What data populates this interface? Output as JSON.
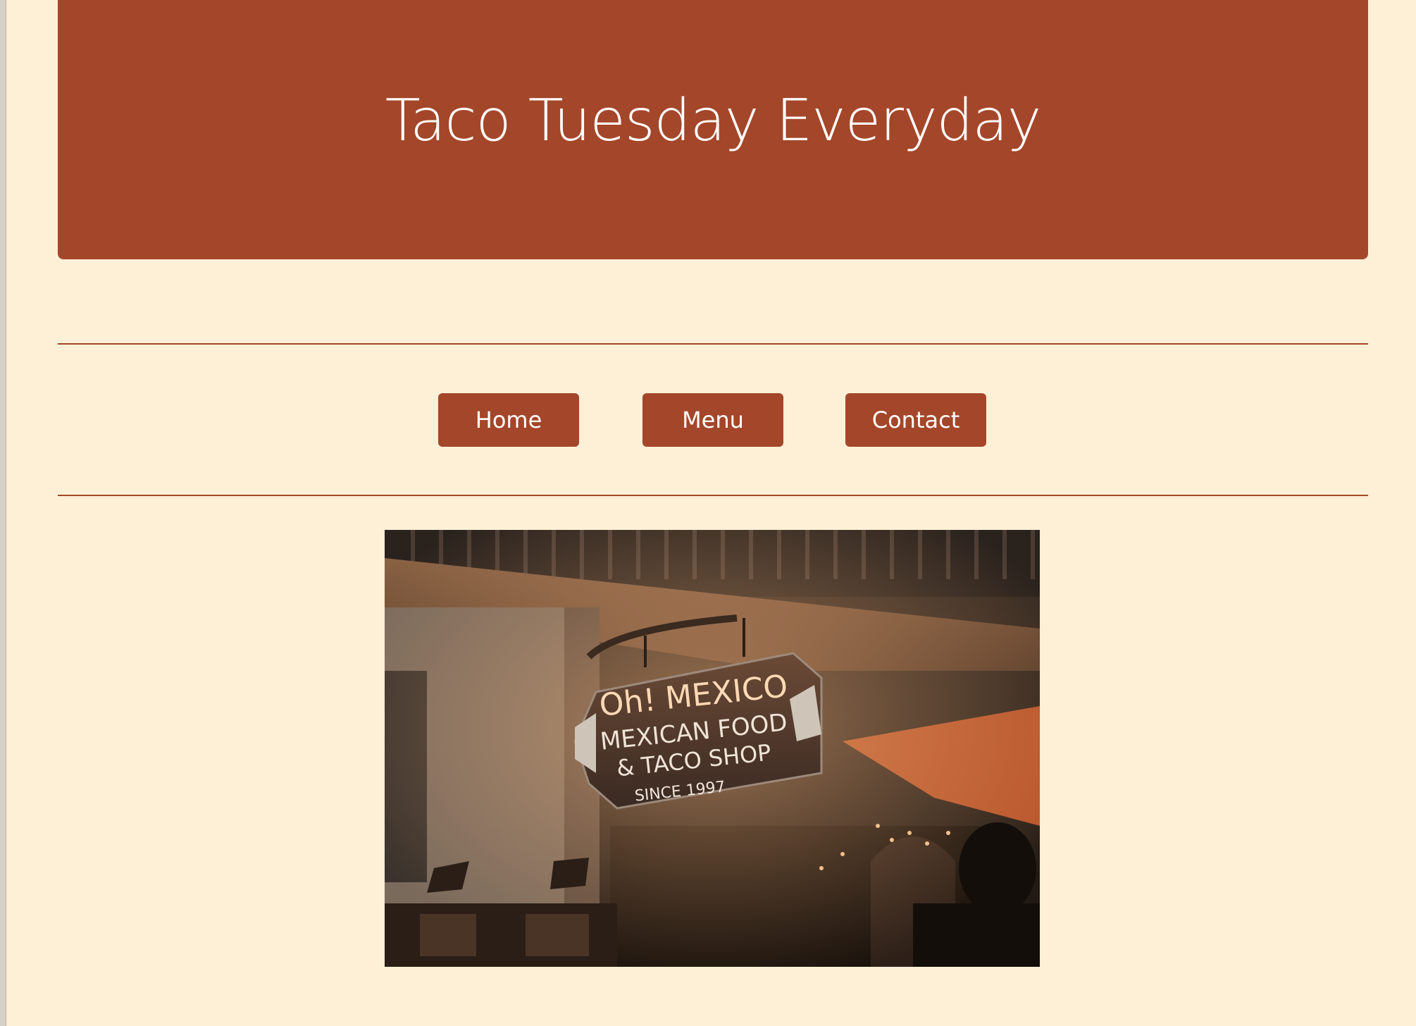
{
  "header": {
    "title": "Taco Tuesday Everyday"
  },
  "nav": {
    "home_label": "Home",
    "menu_label": "Menu",
    "contact_label": "Contact"
  },
  "hero_image": {
    "sign_line_1": "Oh! MEXICO",
    "sign_line_2": "MEXICAN FOOD",
    "sign_line_3": "& TACO SHOP",
    "sign_line_4": "SINCE 1997"
  },
  "colors": {
    "background": "#fdf0d7",
    "accent": "#a44629",
    "text_on_accent": "#ffffff"
  }
}
